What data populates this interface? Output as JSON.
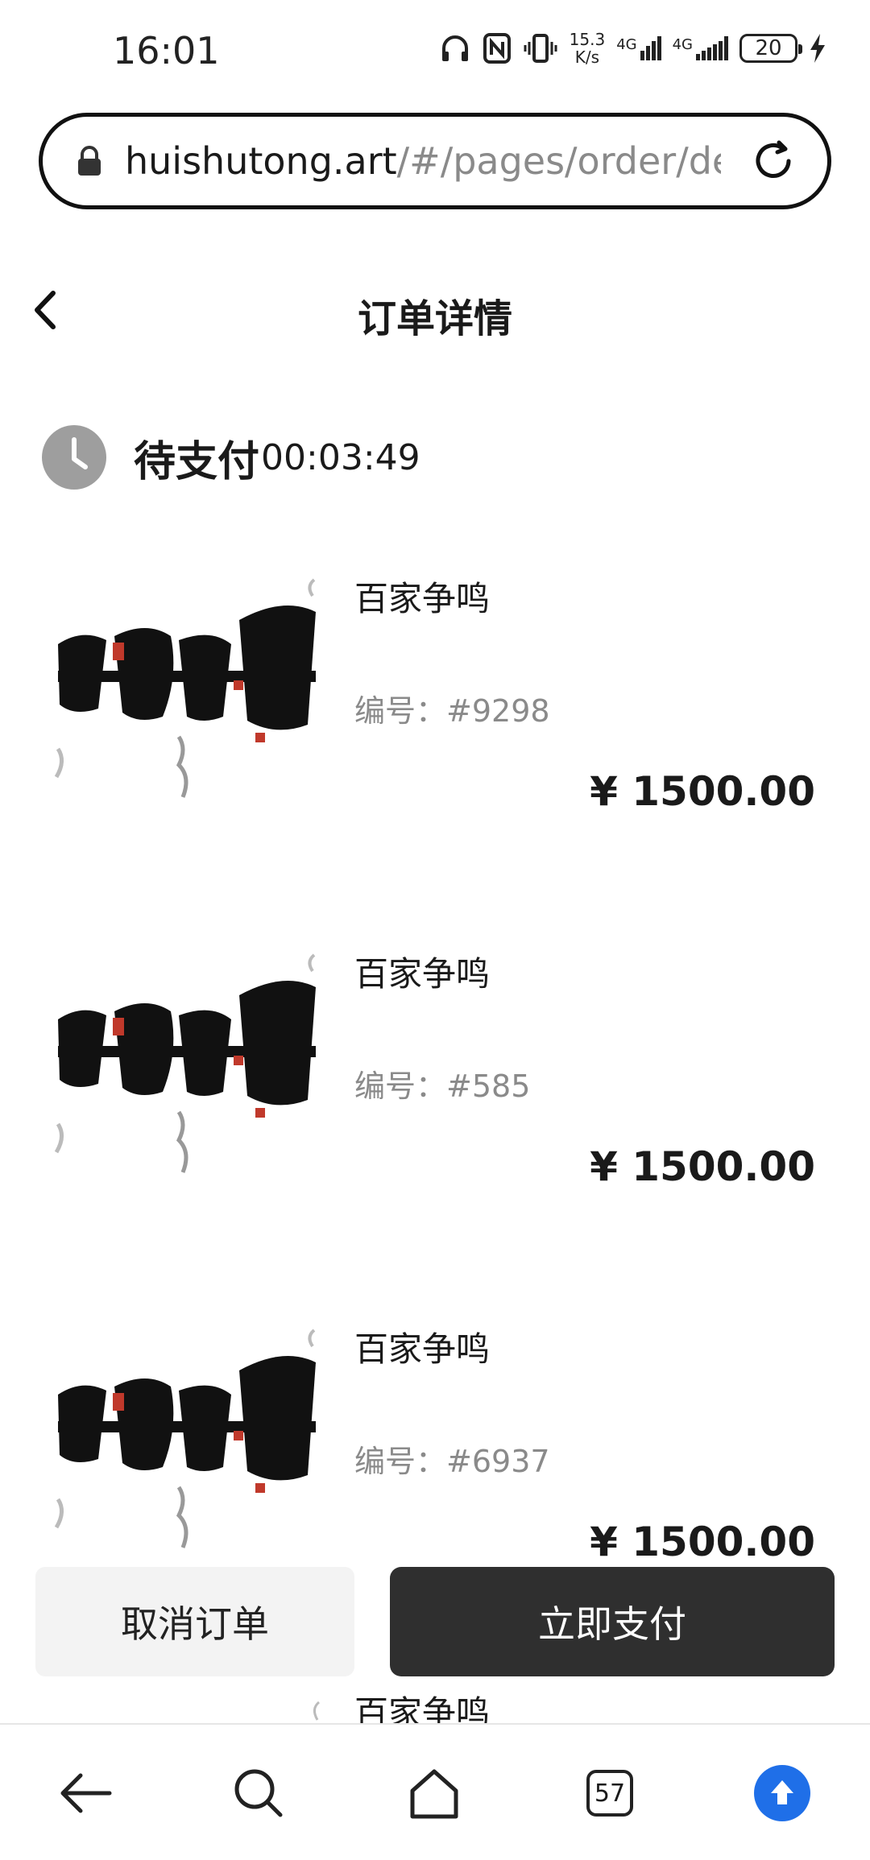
{
  "status_bar": {
    "time": "16:01",
    "net_speed_value": "15.3",
    "net_speed_unit": "K/s",
    "signal1_label": "4G",
    "signal2_label": "4G",
    "battery": "20",
    "icons": [
      "headphones-icon",
      "nfc-icon",
      "vibrate-icon",
      "charging-icon"
    ]
  },
  "browser": {
    "url_host": "huishutong.art",
    "url_path": "/#/pages/order/det"
  },
  "header": {
    "title": "订单详情"
  },
  "order": {
    "status_label": "待支付",
    "countdown": "00:03:49"
  },
  "items": [
    {
      "name": "百家争鸣",
      "code": "编号：#9298",
      "price": "¥ 1500.00"
    },
    {
      "name": "百家争鸣",
      "code": "编号：#585",
      "price": "¥ 1500.00"
    },
    {
      "name": "百家争鸣",
      "code": "编号：#6937",
      "price": "¥ 1500.00"
    }
  ],
  "partial_item": {
    "name": "百家争鸣"
  },
  "actions": {
    "cancel_label": "取消订单",
    "pay_label": "立即支付"
  },
  "browser_nav": {
    "tabs_count": "57"
  },
  "colors": {
    "pay_button": "#2f2f2f",
    "cancel_button": "#f3f3f3",
    "upload_accent": "#1f6fe8",
    "status_icon": "#9e9e9e"
  }
}
